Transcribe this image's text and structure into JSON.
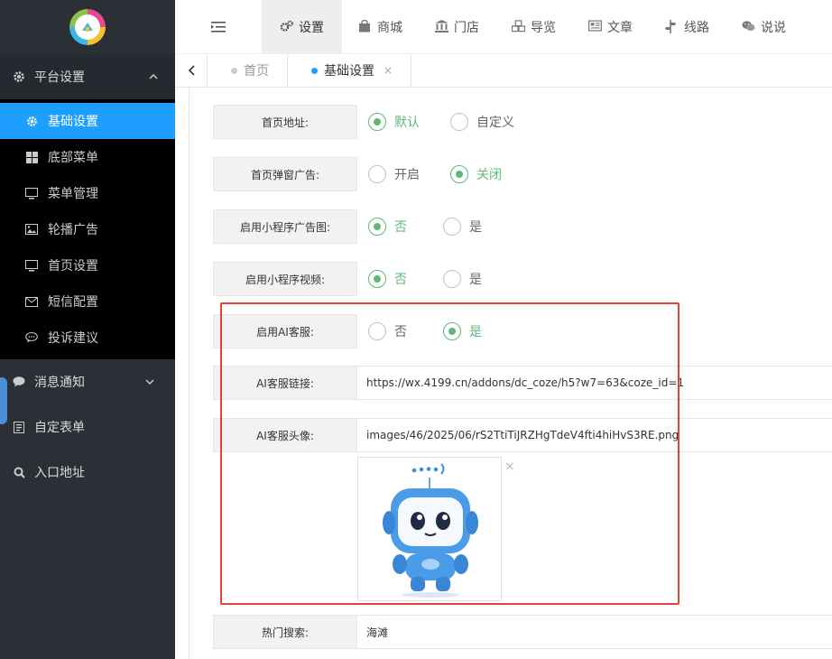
{
  "sidebar": {
    "groups": [
      {
        "label": "平台设置",
        "icon": "gear-icon"
      },
      {
        "label": "消息通知",
        "icon": "chat-bubble-icon"
      },
      {
        "label": "自定表单",
        "icon": "form-icon"
      },
      {
        "label": "入口地址",
        "icon": "search-icon"
      }
    ],
    "sub_items": [
      {
        "label": "基础设置",
        "icon": "gear-icon"
      },
      {
        "label": "底部菜单",
        "icon": "grid-icon"
      },
      {
        "label": "菜单管理",
        "icon": "monitor-icon"
      },
      {
        "label": "轮播广告",
        "icon": "image-icon"
      },
      {
        "label": "首页设置",
        "icon": "monitor-icon"
      },
      {
        "label": "短信配置",
        "icon": "envelope-icon"
      },
      {
        "label": "投诉建议",
        "icon": "comment-icon"
      }
    ]
  },
  "topnav": {
    "items": [
      {
        "label": "设置",
        "icon": "gears-icon"
      },
      {
        "label": "商城",
        "icon": "shopping-bag-icon"
      },
      {
        "label": "门店",
        "icon": "bank-icon"
      },
      {
        "label": "导览",
        "icon": "cubes-icon"
      },
      {
        "label": "文章",
        "icon": "newspaper-icon"
      },
      {
        "label": "线路",
        "icon": "route-icon"
      },
      {
        "label": "说说",
        "icon": "wechat-icon"
      }
    ]
  },
  "tabs": [
    {
      "label": "首页"
    },
    {
      "label": "基础设置",
      "close": "×"
    }
  ],
  "form": {
    "home_url": {
      "label": "首页地址:",
      "options": [
        "默认",
        "自定义"
      ],
      "selected": "默认"
    },
    "popup_ad": {
      "label": "首页弹窗广告:",
      "options": [
        "开启",
        "关闭"
      ],
      "selected": "关闭"
    },
    "mini_ad": {
      "label": "启用小程序广告图:",
      "options": [
        "否",
        "是"
      ],
      "selected": "否"
    },
    "mini_video": {
      "label": "启用小程序视频:",
      "options": [
        "否",
        "是"
      ],
      "selected": "否"
    },
    "ai_service": {
      "label": "启用AI客服:",
      "options": [
        "否",
        "是"
      ],
      "selected": "是"
    },
    "ai_link": {
      "label": "AI客服链接:",
      "value": "https://wx.4199.cn/addons/dc_coze/h5?w7=63&coze_id=1"
    },
    "ai_avatar": {
      "label": "AI客服头像:",
      "value": "images/46/2025/06/rS2TtiTiJRZHgTdeV4fti4hiHvS3RE.png",
      "remove": "×"
    },
    "hot_search": {
      "label": "热门搜索:",
      "value": "海滩"
    }
  },
  "colors": {
    "accent": "#1e9fff",
    "radio_on": "#5fb878",
    "highlight": "#e0433c",
    "sidebar": "#2b2f36"
  }
}
